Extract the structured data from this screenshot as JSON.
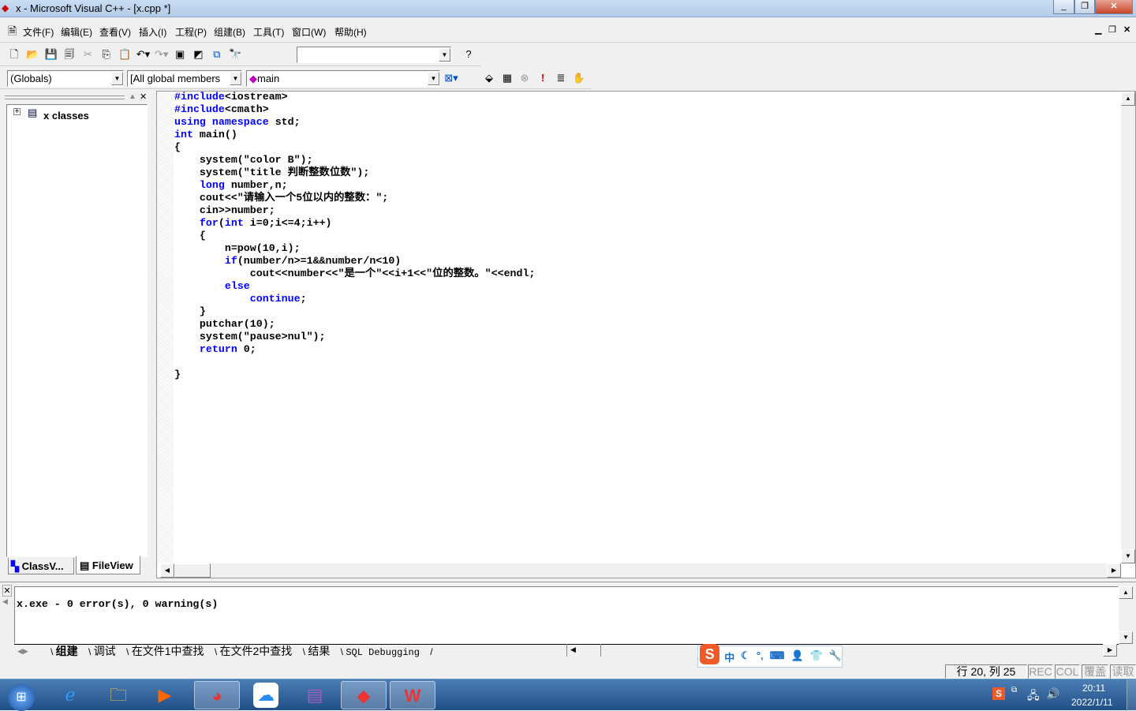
{
  "window": {
    "title": "x - Microsoft Visual C++ - [x.cpp *]",
    "minimize": "_",
    "restore": "❐",
    "close": "✕"
  },
  "menu": [
    "文件(F)",
    "编辑(E)",
    "查看(V)",
    "插入(I)",
    "工程(P)",
    "组建(B)",
    "工具(T)",
    "窗口(W)",
    "帮助(H)"
  ],
  "toolbar": {
    "find_value": ""
  },
  "wizardbar": {
    "class": "(Globals)",
    "filter": "[All global members",
    "member": "main"
  },
  "workspace": {
    "tree_root": "x classes",
    "tabs": [
      "ClassV...",
      "FileView"
    ]
  },
  "editor": {
    "lines": [
      [
        [
          "#include",
          "kw"
        ],
        [
          "<iostream>",
          ""
        ]
      ],
      [
        [
          "#include",
          "kw"
        ],
        [
          "<cmath>",
          ""
        ]
      ],
      [
        [
          "using",
          "kw"
        ],
        [
          " ",
          ""
        ],
        [
          "namespace",
          "kw"
        ],
        [
          " std;",
          ""
        ]
      ],
      [
        [
          "int",
          "kw"
        ],
        [
          " main()",
          ""
        ]
      ],
      [
        [
          "{",
          ""
        ]
      ],
      [
        [
          "    system(\"color B\");",
          ""
        ]
      ],
      [
        [
          "    system(\"title 判断整数位数\");",
          ""
        ]
      ],
      [
        [
          "    ",
          ""
        ],
        [
          "long",
          "kw"
        ],
        [
          " number,n;",
          ""
        ]
      ],
      [
        [
          "    cout<<\"请输入一个5位以内的整数：\";",
          ""
        ]
      ],
      [
        [
          "    cin>>number;",
          ""
        ]
      ],
      [
        [
          "    ",
          ""
        ],
        [
          "for",
          "kw"
        ],
        [
          "(",
          ""
        ],
        [
          "int",
          "kw"
        ],
        [
          " i=0;i<=4;i++)",
          ""
        ]
      ],
      [
        [
          "    {",
          ""
        ]
      ],
      [
        [
          "        n=pow(10,i);",
          ""
        ]
      ],
      [
        [
          "        ",
          ""
        ],
        [
          "if",
          "kw"
        ],
        [
          "(number/n>=1&&number/n<10)",
          ""
        ]
      ],
      [
        [
          "            cout<<number<<\"是一个\"<<i+1<<\"位的整数。\"<<endl;",
          ""
        ]
      ],
      [
        [
          "        ",
          ""
        ],
        [
          "else",
          "kw"
        ]
      ],
      [
        [
          "            ",
          ""
        ],
        [
          "continue",
          "kw"
        ],
        [
          ";",
          ""
        ]
      ],
      [
        [
          "    }",
          ""
        ]
      ],
      [
        [
          "    putchar(10);",
          ""
        ]
      ],
      [
        [
          "    system(\"pause>nul\");",
          ""
        ]
      ],
      [
        [
          "    ",
          ""
        ],
        [
          "return",
          "kw"
        ],
        [
          " 0;",
          ""
        ]
      ],
      [
        [
          "",
          ""
        ]
      ],
      [
        [
          "}",
          ""
        ]
      ]
    ]
  },
  "output": {
    "text": "x.exe - 0 error(s), 0 warning(s)",
    "tabs": [
      "组建",
      "调试",
      "在文件1中查找",
      "在文件2中查找",
      "结果",
      "SQL Debugging"
    ]
  },
  "ime": {
    "items": [
      "中",
      "☾",
      "°,",
      "⌨",
      "👤",
      "👕",
      "🔧"
    ]
  },
  "status": {
    "position": "行 20, 列 25",
    "rec": "REC",
    "col": "COL",
    "ovr": "覆盖",
    "read": "读取"
  },
  "tray": {
    "time": "20:11",
    "date": "2022/1/11"
  },
  "colors": {
    "keyword": "#0000ff",
    "ime_logo": "#f05a28"
  }
}
